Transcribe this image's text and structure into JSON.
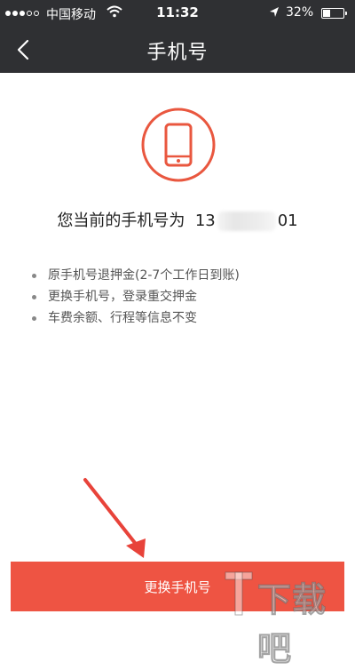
{
  "status_bar": {
    "carrier": "中国移动",
    "time": "11:32",
    "battery_percent": "32%",
    "battery_level": 0.32
  },
  "nav": {
    "title": "手机号",
    "back_icon": "chevron-left-icon"
  },
  "main": {
    "phone_icon": "smartphone-icon",
    "current_number_label": "您当前的手机号为",
    "number_prefix": "13",
    "number_suffix": "01",
    "notes": [
      "原手机号退押金(2-7个工作日到账)",
      "更换手机号，登录重交押金",
      "车费余额、行程等信息不变"
    ]
  },
  "footer": {
    "change_button_label": "更换手机号"
  },
  "watermark": {
    "text": "下载吧"
  },
  "colors": {
    "header_bg": "#2f3033",
    "accent": "#ee5443",
    "icon_ring": "#e9573f"
  }
}
